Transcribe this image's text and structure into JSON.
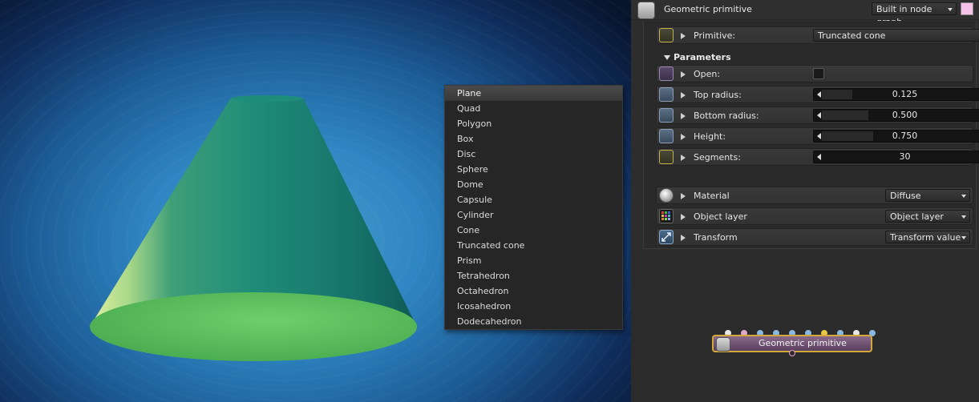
{
  "inspector": {
    "title": "Geometric primitive",
    "mode": "Built in node graph",
    "swatch_color": "#f7c2e8",
    "primitive": {
      "label": "Primitive:",
      "value": "Truncated cone"
    },
    "parameters_title": "Parameters",
    "open": {
      "label": "Open:",
      "checked": false
    },
    "top_radius": {
      "label": "Top radius:",
      "value": "0.125",
      "fraction": 0.19
    },
    "bottom_radius": {
      "label": "Bottom radius:",
      "value": "0.500",
      "fraction": 0.29
    },
    "height": {
      "label": "Height:",
      "value": "0.750",
      "fraction": 0.32
    },
    "segments": {
      "label": "Segments:",
      "value": "30"
    },
    "material": {
      "label": "Material",
      "value": "Diffuse"
    },
    "object_layer": {
      "label": "Object layer",
      "value": "Object layer"
    },
    "transform": {
      "label": "Transform",
      "value": "Transform value"
    }
  },
  "primitive_menu": {
    "items": [
      "Plane",
      "Quad",
      "Polygon",
      "Box",
      "Disc",
      "Sphere",
      "Dome",
      "Capsule",
      "Cylinder",
      "Cone",
      "Truncated cone",
      "Prism",
      "Tetrahedron",
      "Octahedron",
      "Icosahedron",
      "Dodecahedron"
    ],
    "highlighted": "Plane"
  },
  "node": {
    "title": "Geometric primitive",
    "pin_colors": [
      "#e8e8e8",
      "#e0a8c8",
      "#8ab8e0",
      "#8ab8e0",
      "#8ab8e0",
      "#8ab8e0",
      "#e8c84a",
      "#8ab8e0",
      "#e8e8e8",
      "#8ab8e0"
    ],
    "border_color": "#d4a83a"
  }
}
